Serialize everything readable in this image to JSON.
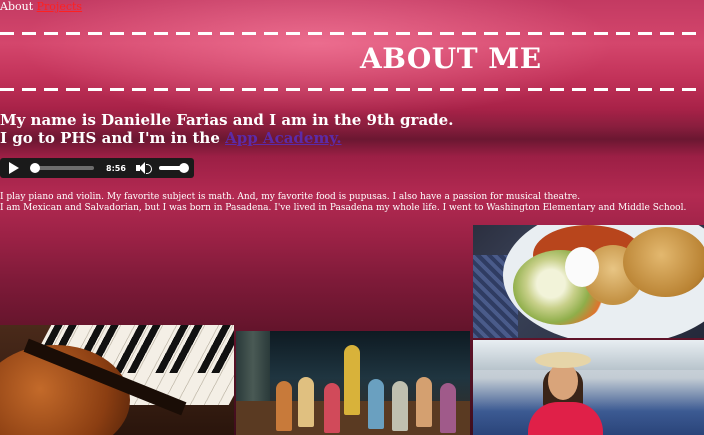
{
  "nav": {
    "about_label": "About",
    "projects_label": "Projects"
  },
  "header": {
    "title": "ABOUT ME"
  },
  "intro": {
    "line1": "My name is Danielle Farias and I am in the 9th grade.",
    "line2_prefix": "I go to PHS and I'm in the",
    "academy_link": "App Academy."
  },
  "audio": {
    "time": "8:56",
    "progress": 0.0,
    "volume": 1.0
  },
  "bio": {
    "line1": "I play piano and violin. My favorite subject is math. And, my favorite food is pupusas. I also have a passion for musical theatre.",
    "line2": "I am Mexican and Salvadorian, but I was born in Pasadena. I've lived in Pasadena my whole life. I went to Washington Elementary and Middle School."
  },
  "colors": {
    "link_red": "#ff2020",
    "link_visited": "#5c2aa8",
    "text": "#ffffff"
  }
}
